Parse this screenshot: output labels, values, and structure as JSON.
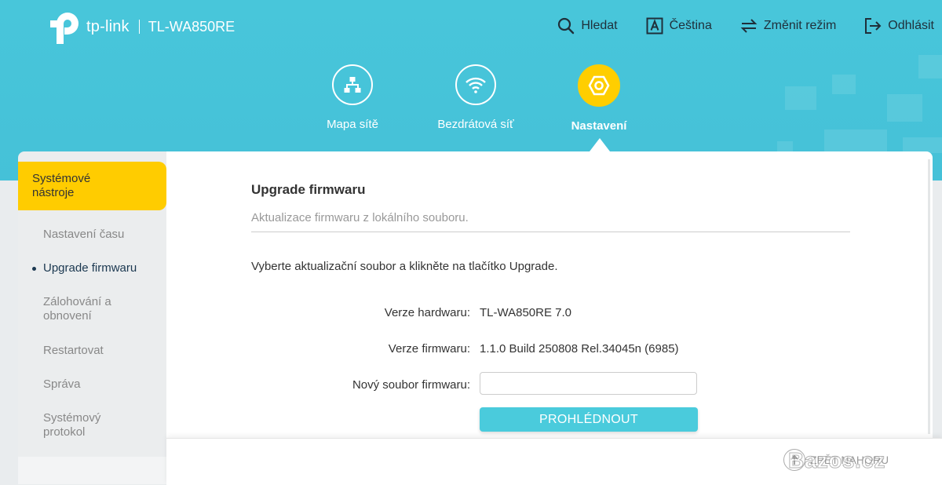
{
  "header": {
    "brand": "tp-link",
    "model": "TL-WA850RE",
    "top_nav": [
      {
        "label": "Hledat",
        "icon": "search-icon"
      },
      {
        "label": "Čeština",
        "icon": "language-icon"
      },
      {
        "label": "Změnit režim",
        "icon": "switch-mode-icon"
      },
      {
        "label": "Odhlásit",
        "icon": "logout-icon"
      }
    ],
    "main_nav": [
      {
        "label": "Mapa sítě",
        "icon": "network-map-icon",
        "active": false
      },
      {
        "label": "Bezdrátová síť",
        "icon": "wifi-icon",
        "active": false
      },
      {
        "label": "Nastavení",
        "icon": "gear-icon",
        "active": true
      }
    ]
  },
  "sidebar": {
    "section": "Systémové nástroje",
    "items": [
      {
        "label": "Nastavení času",
        "active": false
      },
      {
        "label": "Upgrade firmwaru",
        "active": true
      },
      {
        "label": "Zálohování a obnovení",
        "active": false
      },
      {
        "label": "Restartovat",
        "active": false
      },
      {
        "label": "Správa",
        "active": false
      },
      {
        "label": "Systémový protokol",
        "active": false
      }
    ]
  },
  "main": {
    "title": "Upgrade firmwaru",
    "subtitle": "Aktualizace firmwaru z lokálního souboru.",
    "instruction": "Vyberte aktualizační soubor a klikněte na tlačítko Upgrade.",
    "hardware_label": "Verze hardwaru:",
    "hardware_value": "TL-WA850RE 7.0",
    "firmware_label": "Verze firmwaru:",
    "firmware_value": "1.1.0 Build 250808 Rel.34045n (6985)",
    "new_file_label": "Nový soubor firmwaru:",
    "new_file_value": "",
    "browse_label": "PROHLÉDNOUT"
  },
  "footer": {
    "back_to_top": "ZPĚT NAHORU"
  },
  "watermark": "Bazos.cz",
  "colors": {
    "header_bg": "#45c1d8",
    "accent_yellow": "#ffcc00",
    "button": "#4acbdc",
    "active_text": "#1b3850"
  }
}
